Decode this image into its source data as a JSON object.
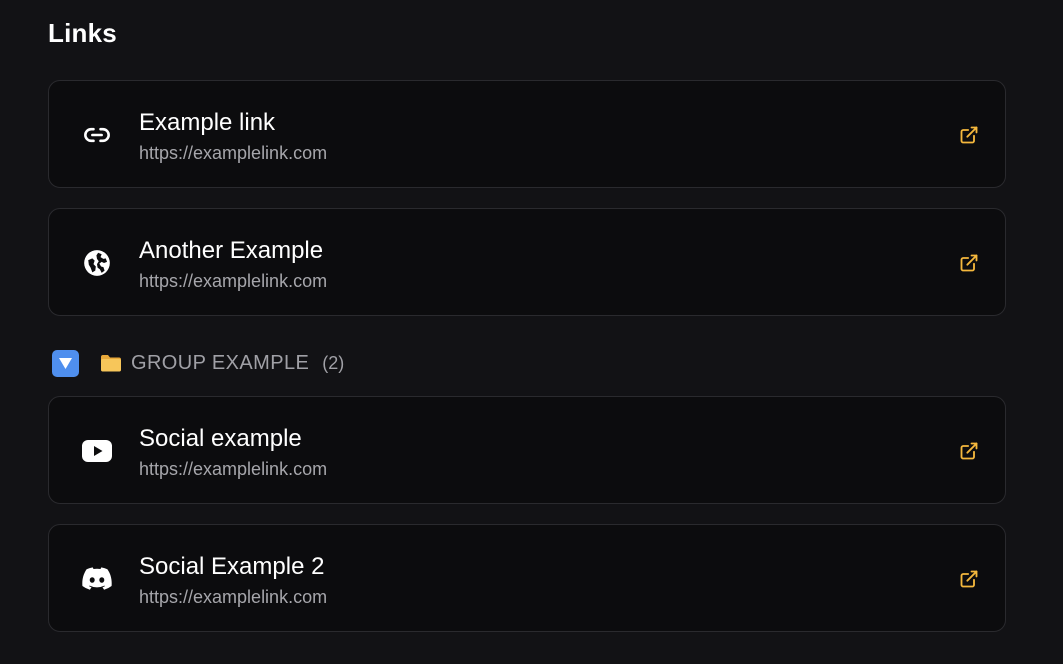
{
  "section": {
    "title": "Links"
  },
  "links": [
    {
      "title": "Example link",
      "url": "https://examplelink.com",
      "icon": "link-icon"
    },
    {
      "title": "Another Example",
      "url": "https://examplelink.com",
      "icon": "globe-icon"
    }
  ],
  "group": {
    "toggle_icon": "triangle-down-icon",
    "folder_icon": "folder-icon",
    "label": "GROUP EXAMPLE",
    "count": "(2)",
    "links": [
      {
        "title": "Social example",
        "url": "https://examplelink.com",
        "icon": "youtube-icon"
      },
      {
        "title": "Social Example 2",
        "url": "https://examplelink.com",
        "icon": "discord-icon"
      }
    ]
  },
  "colors": {
    "background": "#121215",
    "card_background": "#0c0c0e",
    "card_border": "#2a2a2e",
    "accent_external": "#f5b83d",
    "url_text": "#a6a6ab",
    "toggle_blue": "#4f8fee",
    "folder_yellow": "#f7c65a"
  }
}
